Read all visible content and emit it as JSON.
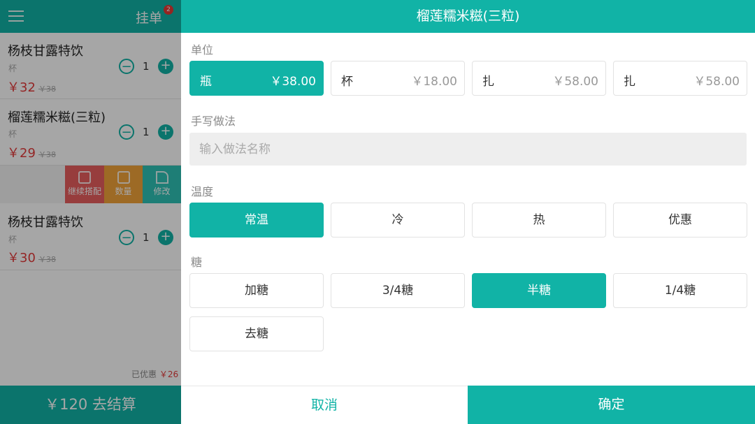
{
  "left": {
    "hang_label": "挂单",
    "hang_badge": "2",
    "items": [
      {
        "name": "杨枝甘露特饮",
        "unit": "杯",
        "price": "￥32",
        "orig": "￥38",
        "qty": "1",
        "minus": "−",
        "plus": "+"
      },
      {
        "name": "榴莲糯米糍(三粒)",
        "unit": "杯",
        "price": "￥29",
        "orig": "￥38",
        "qty": "1",
        "minus": "−",
        "plus": "+"
      },
      {
        "name": "杨枝甘露特饮",
        "unit": "杯",
        "price": "￥30",
        "orig": "￥38",
        "qty": "1",
        "minus": "−",
        "plus": "+"
      }
    ],
    "actions": {
      "combo": "继续搭配",
      "qty": "数量",
      "edit": "修改"
    },
    "discount_label": "已优惠",
    "discount_value": "￥26",
    "checkout": "￥120 去结算"
  },
  "dialog": {
    "title": "榴莲糯米糍(三粒)",
    "unit_label": "单位",
    "units": [
      {
        "label": "瓶",
        "price": "￥38.00"
      },
      {
        "label": "杯",
        "price": "￥18.00"
      },
      {
        "label": "扎",
        "price": "￥58.00"
      },
      {
        "label": "扎",
        "price": "￥58.00"
      }
    ],
    "method_label": "手写做法",
    "method_placeholder": "输入做法名称",
    "temp_label": "温度",
    "temps": [
      "常温",
      "冷",
      "热",
      "优惠"
    ],
    "sugar_label": "糖",
    "sugars": [
      "加糖",
      "3/4糖",
      "半糖",
      "1/4糖",
      "去糖"
    ],
    "cancel": "取消",
    "confirm": "确定"
  }
}
